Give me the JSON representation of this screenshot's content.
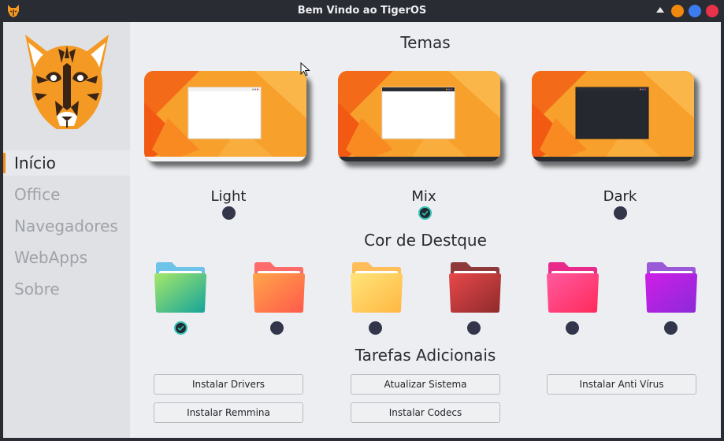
{
  "window": {
    "title": "Bem Vindo ao TigerOS",
    "controls": [
      "collapse-arrow",
      "minimize",
      "maximize",
      "close"
    ],
    "control_colors": {
      "minimize": "#f08a0e",
      "maximize": "#3d7bf0",
      "close": "#e8324a"
    }
  },
  "sidebar": {
    "items": [
      {
        "label": "Início",
        "active": true
      },
      {
        "label": "Office",
        "active": false
      },
      {
        "label": "Navegadores",
        "active": false
      },
      {
        "label": "WebApps",
        "active": false
      },
      {
        "label": "Sobre",
        "active": false
      }
    ]
  },
  "themes": {
    "title": "Temas",
    "options": [
      {
        "label": "Light",
        "selected": false
      },
      {
        "label": "Mix",
        "selected": true
      },
      {
        "label": "Dark",
        "selected": false
      }
    ]
  },
  "accent": {
    "title": "Cor de Destque",
    "options": [
      {
        "name": "green-teal",
        "colors": [
          "#a6e86a",
          "#14a39a"
        ],
        "selected": true
      },
      {
        "name": "orange",
        "colors": [
          "#ffa54a",
          "#ff5a4a"
        ],
        "selected": false
      },
      {
        "name": "yellow",
        "colors": [
          "#ffe47a",
          "#ffb742"
        ],
        "selected": false
      },
      {
        "name": "red",
        "colors": [
          "#e8484a",
          "#8e2a2c"
        ],
        "selected": false
      },
      {
        "name": "pink",
        "colors": [
          "#ff5aa0",
          "#ff2a5a"
        ],
        "selected": false
      },
      {
        "name": "purple",
        "colors": [
          "#d01ee8",
          "#8a2ad8"
        ],
        "selected": false
      }
    ]
  },
  "tasks": {
    "title": "Tarefas Adicionais",
    "buttons": [
      {
        "label": "Instalar Drivers"
      },
      {
        "label": "Atualizar Sistema"
      },
      {
        "label": "Instalar Anti Vírus"
      },
      {
        "label": "Instalar Remmina"
      },
      {
        "label": "Instalar Codecs"
      }
    ]
  }
}
